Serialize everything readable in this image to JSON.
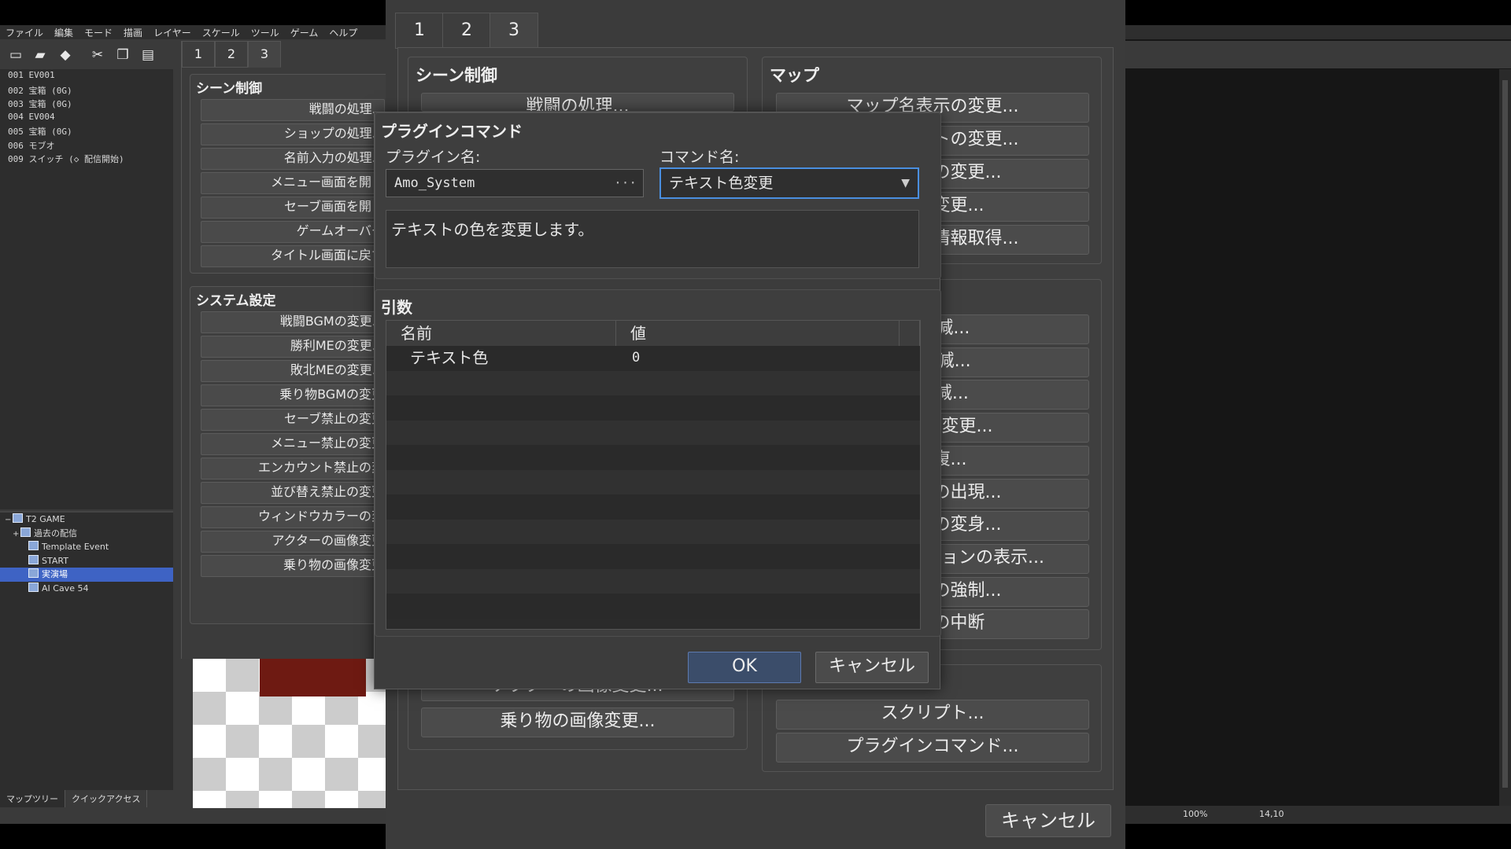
{
  "editor": {
    "menu": [
      "ファイル",
      "編集",
      "モード",
      "描画",
      "レイヤー",
      "スケール",
      "ツール",
      "ゲーム",
      "ヘルプ"
    ],
    "toolbar_icons": [
      "new-file-icon",
      "open-folder-icon",
      "save-icon",
      "cut-icon",
      "copy-icon",
      "paste-icon"
    ],
    "event_list": [
      "001 EV001",
      "002 宝箱 (0G)",
      "003 宝箱 (0G)",
      "004 EV004",
      "005 宝箱 (0G)",
      "006 モブオ",
      "009 スイッチ (◇  配信開始)"
    ],
    "map_tree": [
      {
        "label": "T2 GAME",
        "indent": 0,
        "expander": "−"
      },
      {
        "label": "過去の配信",
        "indent": 1,
        "expander": "+"
      },
      {
        "label": "Template Event",
        "indent": 2,
        "expander": ""
      },
      {
        "label": "START",
        "indent": 2,
        "expander": ""
      },
      {
        "label": "実演場",
        "indent": 2,
        "expander": "",
        "selected": true
      },
      {
        "label": "AI Cave 54",
        "indent": 2,
        "expander": ""
      }
    ],
    "bottom_tabs": [
      "マップツリー",
      "クイックアクセス"
    ],
    "status": {
      "zoom": "100%",
      "coords": "14,10"
    }
  },
  "old_dialog": {
    "tabs": [
      "1",
      "2",
      "3"
    ],
    "scene_title": "シーン制御",
    "scene_buttons": [
      "戦闘の処理...",
      "ショップの処理...",
      "名前入力の処理...",
      "メニュー画面を開く",
      "セーブ画面を開く",
      "ゲームオーバー",
      "タイトル画面に戻す"
    ],
    "system_title": "システム設定",
    "system_buttons": [
      "戦闘BGMの変更...",
      "勝利MEの変更...",
      "敗北MEの変更...",
      "乗り物BGMの変更",
      "セーブ禁止の変更",
      "メニュー禁止の変更",
      "エンカウント禁止の変",
      "並び替え禁止の変更",
      "ウィンドウカラーの変",
      "アクターの画像変更",
      "乗り物の画像変更"
    ]
  },
  "cmd_window": {
    "tabs": [
      "1",
      "2",
      "3"
    ],
    "scene_title": "シーン制御",
    "scene_top_button": "戦闘の処理...",
    "map_title": "マップ",
    "map_buttons": [
      "マップ名表示の変更...",
      "タイルセットの変更...",
      "戦闘背景の変更...",
      "遠景の変更...",
      "指定位置の情報取得..."
    ],
    "right_fragments": [
      "HP増減...",
      "MP増減...",
      "TP増減...",
      "ステート変更...",
      "全回復...",
      "敵キャラの出現...",
      "敵キャラの変身...",
      "戦闘アニメーションの表示...",
      "戦闘行動の強制...",
      "バトルの中断"
    ],
    "left_bottom_partial": "アクターの画像変更...",
    "left_bottom_button": "乗り物の画像変更...",
    "script_button": "スクリプト...",
    "plugin_button": "プラグインコマンド...",
    "cancel": "キャンセル"
  },
  "plugin_dialog": {
    "title": "プラグインコマンド",
    "plugin_label": "プラグイン名:",
    "plugin_value": "Amo_System",
    "plugin_more": "···",
    "command_label": "コマンド名:",
    "command_value": "テキスト色変更",
    "description": "テキストの色を変更します。",
    "args_title": "引数",
    "columns": [
      "名前",
      "値"
    ],
    "rows": [
      {
        "name": "テキスト色",
        "value": "0"
      }
    ],
    "ok": "OK",
    "cancel": "キャンセル"
  }
}
